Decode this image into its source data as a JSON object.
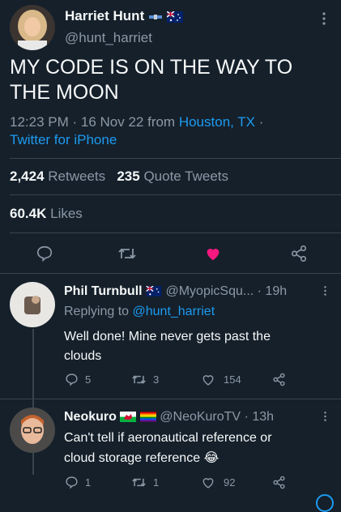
{
  "main_tweet": {
    "author_name": "Harriet Hunt",
    "author_handle": "@hunt_harriet",
    "text_line1": "MY CODE IS ON THE WAY TO",
    "text_line2": "THE MOON",
    "time": "12:23 PM · 16 Nov 22 from",
    "location": "Houston, TX",
    "dot": "·",
    "source": "Twitter for iPhone",
    "retweets_count": "2,424",
    "retweets_label": "Retweets",
    "quotes_count": "235",
    "quotes_label": "Quote Tweets",
    "likes_count": "60.4K",
    "likes_label": "Likes"
  },
  "replies": [
    {
      "author_name": "Phil Turnbull",
      "author_handle": "@MyopicSqu...",
      "time": "· 19h",
      "replying_prefix": "Replying to",
      "replying_to": "@hunt_harriet",
      "text_line1": "Well done! Mine never gets past the",
      "text_line2": "clouds",
      "reply_count": "5",
      "retweet_count": "3",
      "like_count": "154"
    },
    {
      "author_name": "Neokuro",
      "author_handle": "@NeoKuroTV",
      "time": "· 13h",
      "text_line1": "Can't tell if aeronautical reference or",
      "text_line2": "cloud storage reference",
      "emoji": "😂",
      "reply_count": "1",
      "retweet_count": "1",
      "like_count": "92"
    }
  ],
  "colors": {
    "background": "#15202b",
    "accent": "#1d9bf0",
    "like": "#f91880",
    "muted": "#8b98a5"
  },
  "icons": [
    "more-icon",
    "reply-icon",
    "retweet-icon",
    "like-icon",
    "share-icon",
    "satellite-icon",
    "australia-flag-icon",
    "wales-flag-icon",
    "rainbow-flag-icon"
  ]
}
